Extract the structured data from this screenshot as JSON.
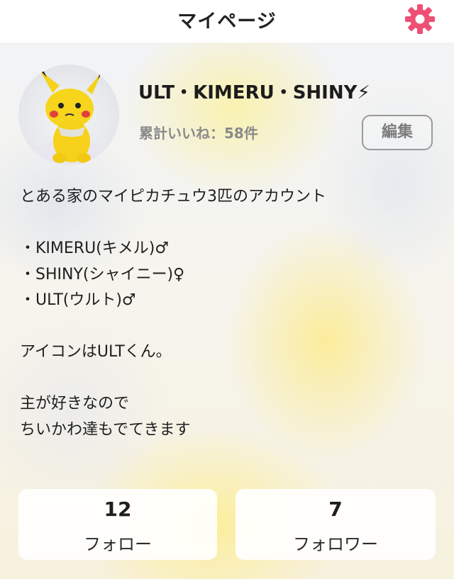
{
  "header": {
    "title": "マイページ",
    "settings_icon": "gear-icon",
    "settings_icon_color": "#ee4f75"
  },
  "profile": {
    "avatar_icon": "pikachu-plush-avatar",
    "display_name": "ULT・KIMERU・SHINY⚡",
    "likes": "累計いいね：58件",
    "edit_label": "編集"
  },
  "bio": {
    "lines": [
      "とある家のマイピカチュウ3匹のアカウント",
      "",
      "・KIMERU(キメル)♂",
      "・SHINY(シャイニー)♀",
      "・ULT(ウルト)♂",
      "",
      "アイコンはULTくん。",
      "",
      "主が好きなので",
      "ちいかわ達もでてきます"
    ]
  },
  "stats": {
    "follow": {
      "count": "12",
      "label": "フォロー"
    },
    "follower": {
      "count": "7",
      "label": "フォロワー"
    }
  }
}
